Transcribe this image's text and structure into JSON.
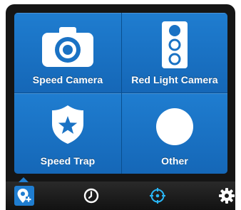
{
  "report_grid": {
    "tiles": [
      {
        "label": "Speed Camera",
        "icon": "camera-icon"
      },
      {
        "label": "Red Light Camera",
        "icon": "traffic-light-icon"
      },
      {
        "label": "Speed Trap",
        "icon": "shield-star-icon"
      },
      {
        "label": "Other",
        "icon": "circle-icon"
      }
    ]
  },
  "tabbar": {
    "items": [
      {
        "icon": "add-location-icon",
        "selected": true
      },
      {
        "icon": "clock-icon",
        "selected": false
      },
      {
        "icon": "crosshair-icon",
        "selected": false
      },
      {
        "icon": "gear-icon",
        "selected": false
      }
    ]
  },
  "colors": {
    "tile_blue": "#1f7dd0",
    "tile_blue_dark": "#1567b7",
    "crosshair_accent": "#29b6f6",
    "tabbar_bg": "#1a1a1a"
  }
}
